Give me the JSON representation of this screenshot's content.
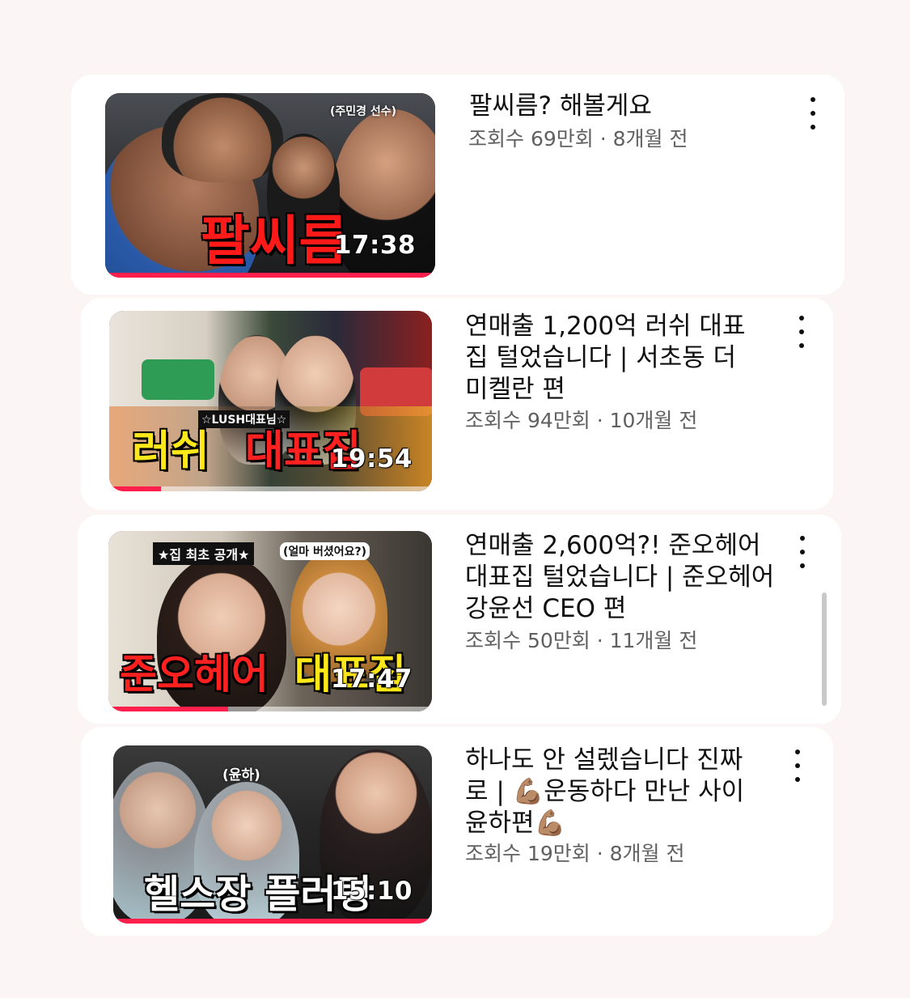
{
  "videos": [
    {
      "title": "팔씨름? 해볼게요",
      "views": "조회수 69만회",
      "age": "8개월 전",
      "duration": "17:38",
      "caption": "팔씨름",
      "tag": "(주민경 선수)",
      "progress": 1.0
    },
    {
      "title": "연매출 1,200억 러쉬 대표 집 털었습니다 | 서초동 더 미켈란 편",
      "views": "조회수 94만회",
      "age": "10개월 전",
      "duration": "19:54",
      "caption_a": "러쉬",
      "caption_b": "대표집",
      "tag": "☆LUSH대표님☆",
      "progress": 0.16
    },
    {
      "title": "연매출 2,600억?! 준오헤어 대표집 털었습니다 | 준오헤어 강윤선 CEO 편",
      "views": "조회수 50만회",
      "age": "11개월 전",
      "duration": "17:47",
      "caption_a": "준오헤어",
      "caption_b": "대표집",
      "tag": "★집 최초 공개★",
      "tag2": "(얼마 버셨어요?)",
      "progress": 0.37
    },
    {
      "title": "하나도 안 설렜습니다 진짜로 | 💪🏽운동하다 만난 사이 윤하편💪🏽",
      "views": "조회수 19만회",
      "age": "8개월 전",
      "duration": "15:10",
      "caption": "헬스장 플러팅",
      "tag": "(윤하)",
      "progress": 1.0
    }
  ],
  "separator": " · ",
  "colors": {
    "progress": "#ff1f4d",
    "title": "#0f0f0f",
    "meta": "#606060",
    "background": "#fbf6f5"
  }
}
